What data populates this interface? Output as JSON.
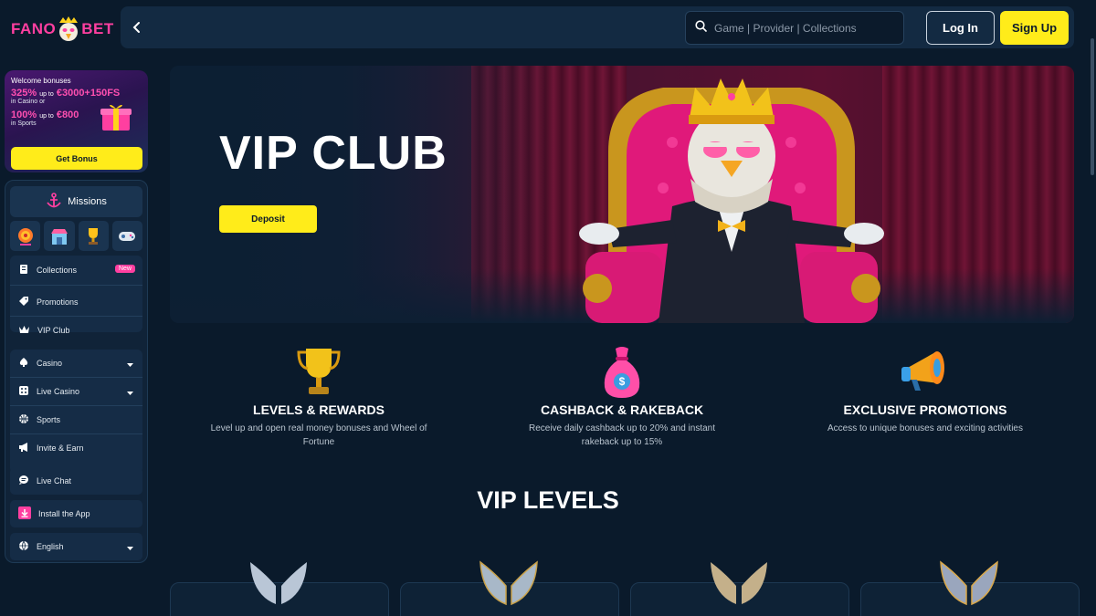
{
  "brand": {
    "logo_left": "FANO",
    "logo_right": "BET",
    "accent": "#ff3fa0",
    "cta_color": "#ffec1a",
    "background": "#0a1a2b"
  },
  "header": {
    "back_icon": "chevron-left-icon",
    "search_placeholder": "Game | Provider | Collections",
    "login_label": "Log In",
    "signup_label": "Sign Up"
  },
  "bonus": {
    "intro": "Welcome bonuses",
    "casino_offer": "325%",
    "casino_upto": "up to",
    "casino_amount": "€3000+150FS",
    "casino_label": "in Casino or",
    "sports_offer": "100%",
    "sports_upto": "up to",
    "sports_amount": "€800",
    "sports_label": "in Sports",
    "button": "Get Bonus"
  },
  "sidebar": {
    "missions": "Missions",
    "quick_icons": [
      "wheel-icon",
      "shop-icon",
      "trophy-icon",
      "gamepad-icon"
    ],
    "items": [
      {
        "label": "Collections",
        "icon": "collections-icon",
        "badge": "New"
      },
      {
        "label": "Promotions",
        "icon": "tag-icon"
      },
      {
        "label": "VIP Club",
        "icon": "crown-icon"
      },
      {
        "label": "Casino",
        "icon": "spade-icon"
      },
      {
        "label": "Live Casino",
        "icon": "dice-icon"
      },
      {
        "label": "Sports",
        "icon": "ball-icon"
      },
      {
        "label": "Invite & Earn",
        "icon": "megaphone-icon"
      },
      {
        "label": "Live Chat",
        "icon": "chat-icon"
      },
      {
        "label": "Install the App",
        "icon": "download-icon"
      },
      {
        "label": "English",
        "icon": "globe-icon"
      }
    ]
  },
  "hero": {
    "title": "VIP CLUB",
    "button": "Deposit"
  },
  "features": [
    {
      "title": "LEVELS & REWARDS",
      "desc": "Level up and open real money bonuses and Wheel of Fortune",
      "icon": "trophy-icon"
    },
    {
      "title": "CASHBACK & RAKEBACK",
      "desc": "Receive daily cashback up to 20% and instant rakeback up to 15%",
      "icon": "money-bag-icon"
    },
    {
      "title": "EXCLUSIVE PROMOTIONS",
      "desc": "Access to unique bonuses and exciting activities",
      "icon": "megaphone-icon"
    }
  ],
  "vip_levels": {
    "title": "VIP LEVELS",
    "levels": [
      {
        "icon": "wings-icon",
        "tint": "#b9c6d6"
      },
      {
        "icon": "wings-icon",
        "tint": "#a8b8c8"
      },
      {
        "icon": "wings-icon",
        "tint": "#c4b08a"
      },
      {
        "icon": "wings-icon",
        "tint": "#9aa6bd"
      }
    ]
  }
}
